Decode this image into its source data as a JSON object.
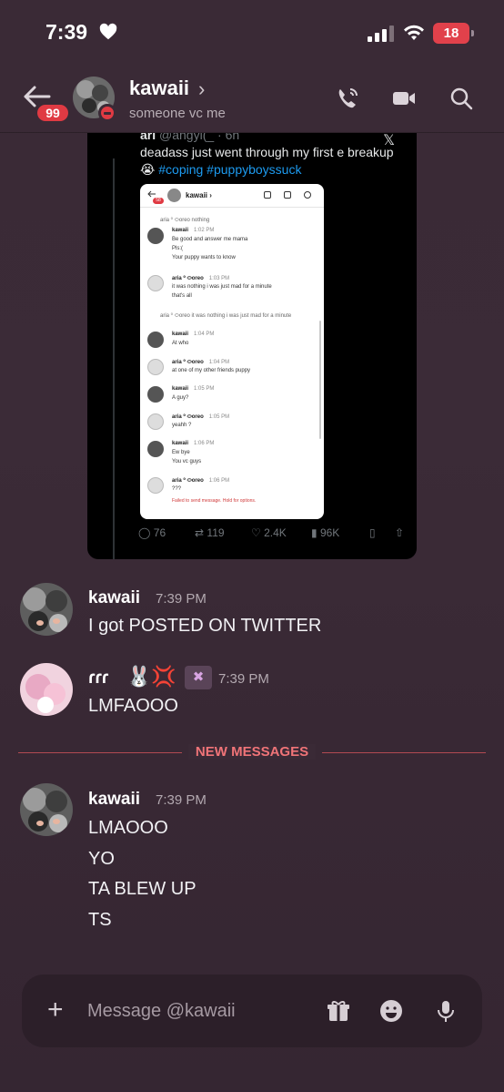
{
  "status_bar": {
    "time": "7:39",
    "battery": "18"
  },
  "header": {
    "unread_badge": "99",
    "name": "kawaii",
    "chevron": "›",
    "subtitle": "someone vc me",
    "icons": [
      "back-arrow-icon",
      "phone-call-icon",
      "video-camera-icon",
      "search-icon"
    ]
  },
  "embed": {
    "tweet_author": "ari",
    "tweet_handle": "@angyl(_ · 6h",
    "tweet_text": "deadass just went through my first e breakup",
    "tweet_emoji": "😭",
    "tweet_tags": "#coping #puppyboyssuck",
    "stats": {
      "replies": "76",
      "retweets": "119",
      "likes": "2.4K",
      "views": "96K"
    },
    "inner": {
      "badge": "58",
      "name": "kawaii ›",
      "messages": [
        {
          "reply_to": "aria ⁰ ⬭oreo nothing"
        },
        {
          "author": "kawaii",
          "time": "1:02 PM",
          "lines": [
            "Be good and answer me mama",
            "Pls:(",
            "Your puppy wants to know"
          ]
        },
        {
          "author": "aria ⁰ ⬭oreo",
          "time": "1:03 PM",
          "lines": [
            "it was nothing i was just mad for a minute",
            "that's all"
          ]
        },
        {
          "reply_to": "aria ⁰ ⬭oreo it was nothing i was just mad for a minute"
        },
        {
          "author": "kawaii",
          "time": "1:04 PM",
          "lines": [
            "At who"
          ]
        },
        {
          "author": "aria ⁰ ⬭oreo",
          "time": "1:04 PM",
          "lines": [
            "at one of my other friends puppy"
          ]
        },
        {
          "author": "kawaii",
          "time": "1:05 PM",
          "lines": [
            "A guy?"
          ]
        },
        {
          "author": "aria ⁰ ⬭oreo",
          "time": "1:05 PM",
          "lines": [
            "yeahh ?"
          ]
        },
        {
          "author": "kawaii",
          "time": "1:06 PM",
          "lines": [
            "Ew bye",
            "You vc guys"
          ]
        },
        {
          "author": "aria ⁰ ⬭oreo",
          "time": "1:06 PM",
          "lines": [
            "???"
          ]
        }
      ],
      "failed": "Failed to send message. Hold for options."
    }
  },
  "messages": [
    {
      "author": "kawaii",
      "time": "7:39 PM",
      "lines": [
        "I got POSTED ON TWITTER"
      ]
    },
    {
      "author": "ɾɾɾ",
      "emojis": "🐰💢",
      "role": "✖",
      "time": "7:39 PM",
      "lines": [
        "LMFAOOO"
      ]
    },
    {
      "author": "kawaii",
      "time": "7:39 PM",
      "lines": [
        "LMAOOO",
        "YO",
        "TA BLEW UP",
        "TS"
      ]
    }
  ],
  "new_messages_label": "NEW MESSAGES",
  "composer": {
    "placeholder": "Message @kawaii",
    "icons": [
      "plus-icon",
      "gift-icon",
      "emoji-icon",
      "microphone-icon"
    ]
  },
  "colors": {
    "background": "#3a2a36",
    "accent_red": "#e03a43",
    "new_messages": "#f07478",
    "twitter_blue": "#1d9bf0"
  }
}
